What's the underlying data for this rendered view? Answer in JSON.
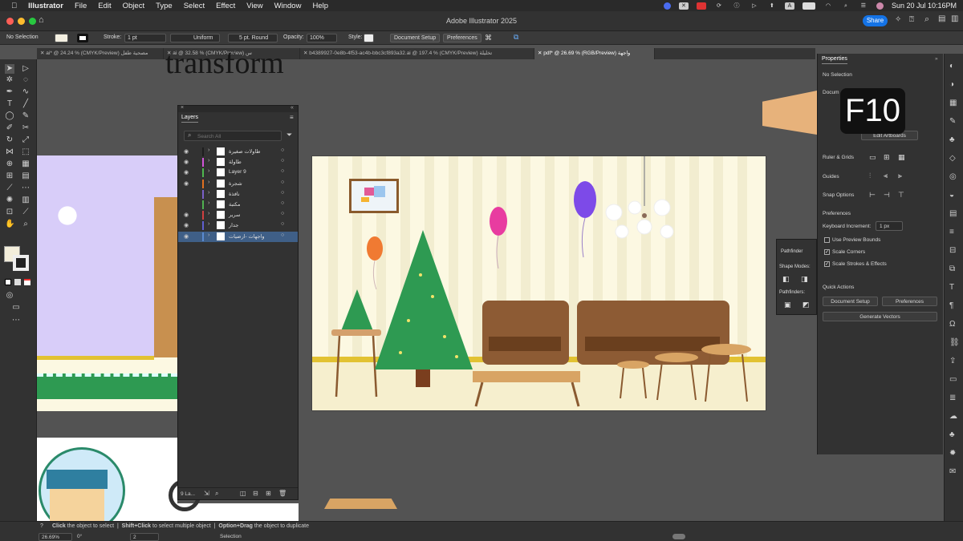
{
  "menubar": {
    "app": "Illustrator",
    "items": [
      "File",
      "Edit",
      "Object",
      "Type",
      "Select",
      "Effect",
      "View",
      "Window",
      "Help"
    ],
    "datetime": "Sun 20 Jul  10:16PM"
  },
  "titlebar": {
    "title": "Adobe Illustrator 2025",
    "share": "Share"
  },
  "control": {
    "selection": "No Selection",
    "stroke_label": "Stroke:",
    "stroke_value": "1 pt",
    "uniform": "Uniform",
    "brush": "5 pt. Round",
    "opacity_label": "Opacity:",
    "opacity_value": "100%",
    "style_label": "Style:",
    "doc_setup": "Document Setup",
    "preferences": "Preferences"
  },
  "tabs": [
    "ai* @ 24.24 % (CMYK/Preview) مصحية طفل",
    "ai @ 32.58 % (CMYK/Preview) س",
    "b4389927-0e8b-4f53-ac4b-bbc3cf893a32.ai @ 197.4 % (CMYK/Preview) تخليلة",
    "pdf* @ 26.69 % (RGB/Preview) واجهة"
  ],
  "canvas": {
    "heading_fragment": "transform"
  },
  "layers": {
    "title": "Layers",
    "search_placeholder": "Search All",
    "footer_count": "9 La...",
    "rows": [
      {
        "name": "طاولات صغيرة",
        "color": "#1e1e1e",
        "eye": true
      },
      {
        "name": "طاولة",
        "color": "#d155d8",
        "eye": true
      },
      {
        "name": "Layer 9",
        "color": "#4fb84f",
        "eye": true
      },
      {
        "name": "شجرة",
        "color": "#e07020",
        "eye": true
      },
      {
        "name": "نافذة",
        "color": "#7a60c8",
        "eye": false
      },
      {
        "name": "مكتبة",
        "color": "#50b050",
        "eye": false
      },
      {
        "name": "سرير",
        "color": "#d04040",
        "eye": true
      },
      {
        "name": "جدار",
        "color": "#6060d0",
        "eye": true
      },
      {
        "name": "واجهات -ارضيات",
        "color": "#5a8ad0",
        "eye": true
      }
    ]
  },
  "properties": {
    "title": "Properties",
    "no_selection": "No Selection",
    "document": "Docum",
    "edit_artboards": "Edit Artboards",
    "ruler_grids": "Ruler & Grids",
    "guides": "Guides",
    "snap_options": "Snap Options",
    "preferences": "Preferences",
    "keyboard_increment": "Keyboard Increment:",
    "keyboard_value": "1 px",
    "use_preview_bounds": "Use Preview Bounds",
    "scale_corners": "Scale Corners",
    "scale_strokes": "Scale Strokes & Effects",
    "quick_actions": "Quick Actions",
    "document_setup": "Document Setup",
    "preferences_btn": "Preferences",
    "generate_vectors": "Generate Vectors"
  },
  "pathfinder": {
    "title": "Pathfinder",
    "shape_modes": "Shape Modes:",
    "pathfinders": "Pathfinders:"
  },
  "keycast": "F10",
  "status": {
    "hint_click": "Click",
    "hint_1": "the object to select",
    "hint_shift": "Shift+Click",
    "hint_2": "to select multiple object",
    "hint_option": "Option+Drag",
    "hint_3": "the object to duplicate",
    "zoom": "26.69%",
    "rotation": "0°",
    "artboard": "2",
    "mode": "Selection"
  }
}
